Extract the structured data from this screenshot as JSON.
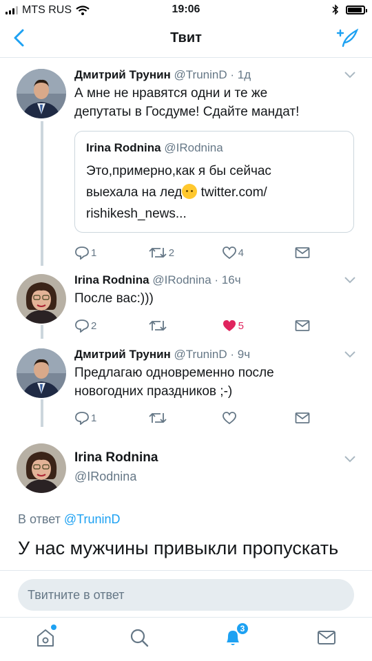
{
  "status_bar": {
    "carrier": "MTS RUS",
    "time": "19:06"
  },
  "nav": {
    "title": "Твит"
  },
  "tweets": [
    {
      "name": "Дмитрий Трунин",
      "handle": "@TruninD",
      "time": "· 1д",
      "text_lines": [
        "А мне не нравятся одни и те же",
        "депутаты в Госдуме! Сдайте мандат!"
      ],
      "quote": {
        "name": "Irina Rodnina",
        "handle": "@IRodnina",
        "line1": "Это,примерно,как я бы сейчас",
        "line2_a": "выехала на лед",
        "line2_b": " twitter.com/",
        "line3": "rishikesh_news..."
      },
      "replies": "1",
      "retweets": "2",
      "likes": "4"
    },
    {
      "name": "Irina Rodnina",
      "handle": "@IRodnina",
      "time": "· 16ч",
      "text_lines": [
        "После вас:)))"
      ],
      "replies": "2",
      "retweets": "",
      "likes": "5"
    },
    {
      "name": "Дмитрий Трунин",
      "handle": "@TruninD",
      "time": "· 9ч",
      "text_lines": [
        "Предлагаю одновременно после",
        "новогодних праздников ;-)"
      ],
      "replies": "1",
      "retweets": "",
      "likes": ""
    }
  ],
  "main_tweet": {
    "name": "Irina Rodnina",
    "handle": "@IRodnina",
    "reply_prefix": "В ответ ",
    "reply_to": "@TruninD",
    "text": "У нас мужчины привыкли пропускать"
  },
  "reply_box": {
    "placeholder": "Твитните в ответ"
  },
  "tabbar": {
    "notifications_badge": "3"
  },
  "colors": {
    "accent": "#1da1f2",
    "like": "#e0245e",
    "muted": "#657786"
  }
}
